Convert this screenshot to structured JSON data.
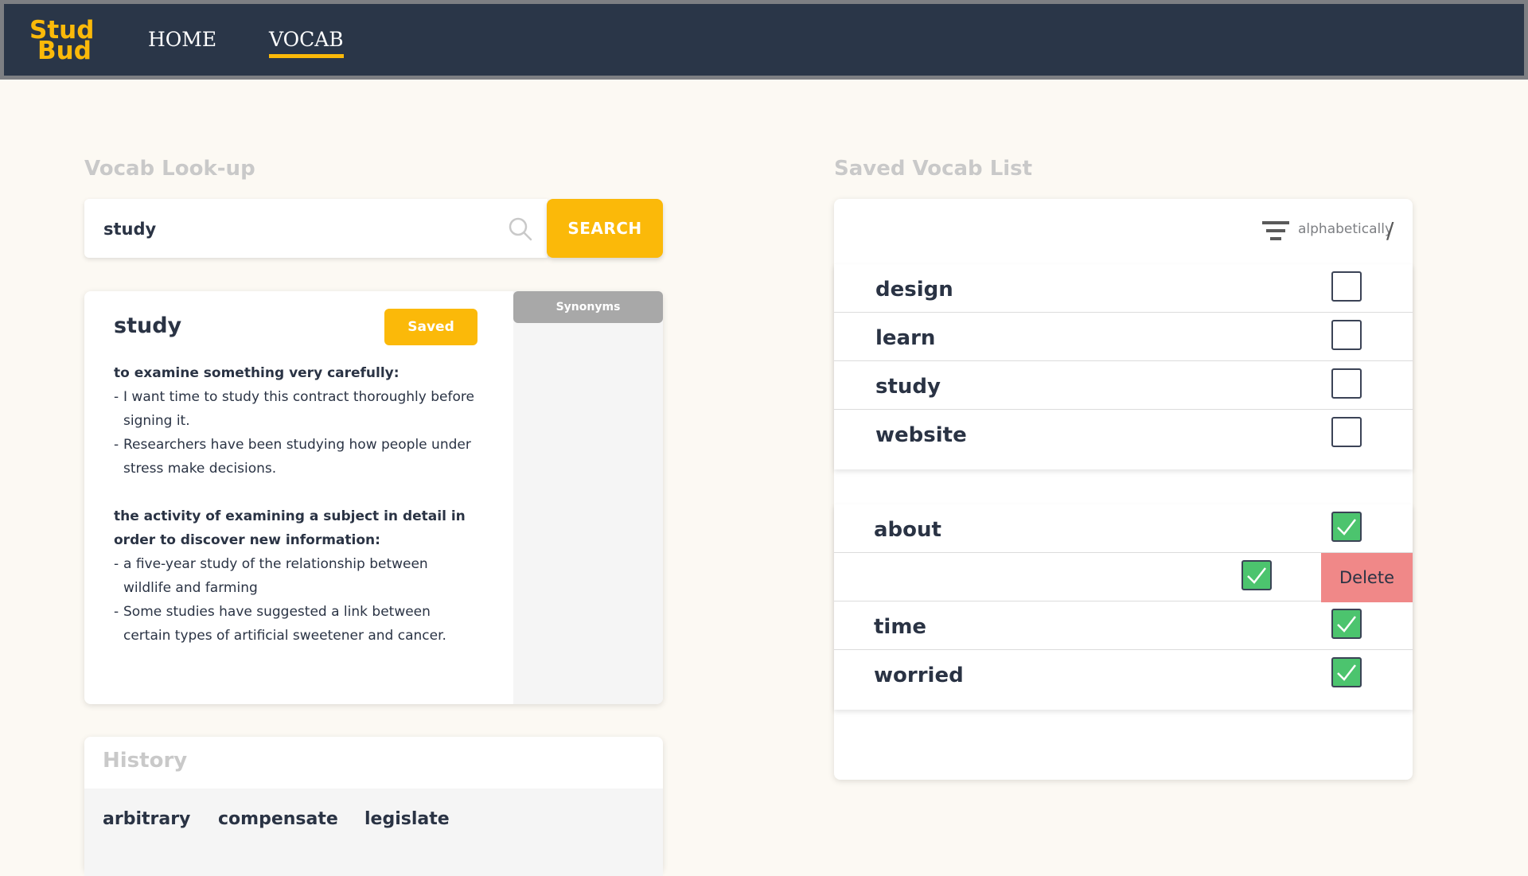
{
  "app": {
    "logo_line1": "Stud",
    "logo_line2": "Bud",
    "nav": [
      {
        "label": "HOME",
        "active": false
      },
      {
        "label": "VOCAB",
        "active": true
      }
    ]
  },
  "lookup": {
    "title": "Vocab Look-up",
    "search_value": "study",
    "search_button": "SEARCH"
  },
  "definition": {
    "word": "study",
    "saved_label": "Saved",
    "synonyms_tab": "Synonyms",
    "senses": [
      {
        "head": "to examine something very carefully:",
        "examples": [
          "I want time to study this contract thoroughly before signing it.",
          "Researchers have been studying how people under stress make decisions."
        ]
      },
      {
        "head": "the activity of examining a subject in detail in order to discover new information:",
        "examples": [
          "a five-year study of the relationship between wildlife and farming",
          "Some studies have suggested a link between certain types of artificial sweetener and cancer."
        ]
      }
    ]
  },
  "history": {
    "title": "History",
    "items": [
      "arbitrary",
      "compensate",
      "legislate"
    ]
  },
  "saved": {
    "title": "Saved Vocab List",
    "sort_label": "alphabetically",
    "sort_separator": "/",
    "unchecked": [
      {
        "word": "design",
        "checked": false
      },
      {
        "word": "learn",
        "checked": false
      },
      {
        "word": "study",
        "checked": false
      },
      {
        "word": "website",
        "checked": false
      }
    ],
    "checked": [
      {
        "word": "about",
        "checked": true
      },
      {
        "word": "",
        "checked": true,
        "swiped": true
      },
      {
        "word": "time",
        "checked": true
      },
      {
        "word": "worried",
        "checked": true
      }
    ],
    "delete_label": "Delete"
  },
  "colors": {
    "accent": "#fbb909",
    "header_bg": "#2a3648",
    "check_green": "#4cc46e",
    "delete_red": "#f08888",
    "page_bg": "#fcf9f3"
  }
}
